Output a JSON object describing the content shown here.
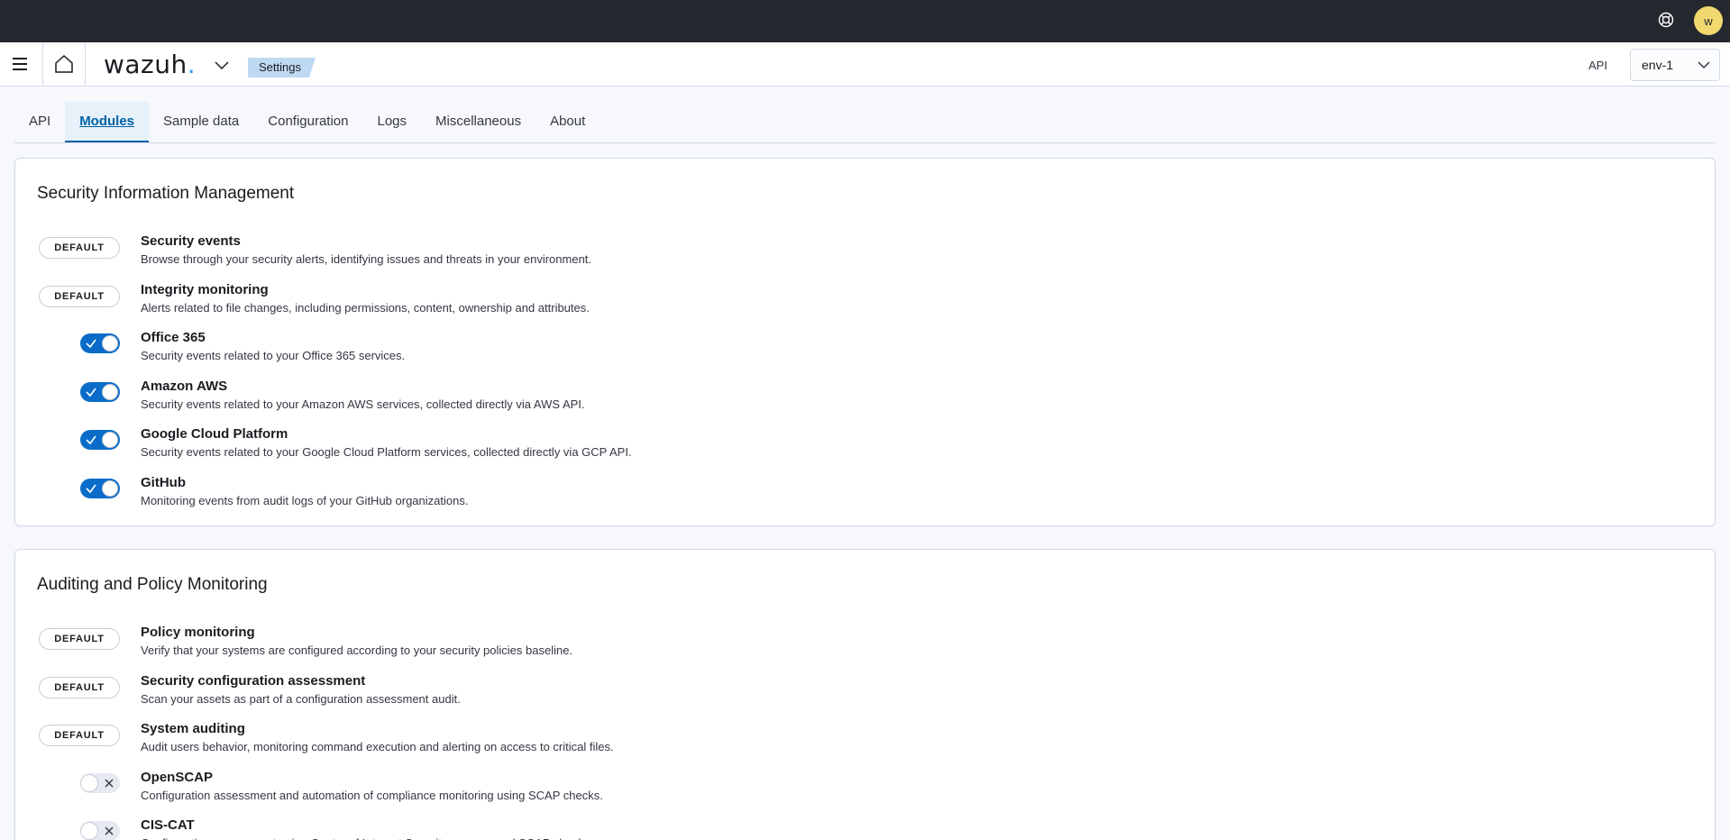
{
  "topbar": {
    "help_icon": "help-lifebuoy-icon",
    "avatar_letter": "w"
  },
  "header": {
    "menu_icon": "hamburger-menu-icon",
    "home_icon": "home-icon",
    "logo_text": "wazuh",
    "logo_dot": ".",
    "breadcrumb": "Settings",
    "api_label": "API",
    "env_value": "env-1"
  },
  "tabs": [
    {
      "label": "API"
    },
    {
      "label": "Modules",
      "selected": true
    },
    {
      "label": "Sample data"
    },
    {
      "label": "Configuration"
    },
    {
      "label": "Logs"
    },
    {
      "label": "Miscellaneous"
    },
    {
      "label": "About"
    }
  ],
  "sections": [
    {
      "title": "Security Information Management",
      "modules": [
        {
          "control": "badge",
          "badge": "DEFAULT",
          "name": "Security events",
          "desc": "Browse through your security alerts, identifying issues and threats in your environment."
        },
        {
          "control": "badge",
          "badge": "DEFAULT",
          "name": "Integrity monitoring",
          "desc": "Alerts related to file changes, including permissions, content, ownership and attributes."
        },
        {
          "control": "switch",
          "enabled": true,
          "name": "Office 365",
          "desc": "Security events related to your Office 365 services."
        },
        {
          "control": "switch",
          "enabled": true,
          "name": "Amazon AWS",
          "desc": "Security events related to your Amazon AWS services, collected directly via AWS API."
        },
        {
          "control": "switch",
          "enabled": true,
          "name": "Google Cloud Platform",
          "desc": "Security events related to your Google Cloud Platform services, collected directly via GCP API."
        },
        {
          "control": "switch",
          "enabled": true,
          "name": "GitHub",
          "desc": "Monitoring events from audit logs of your GitHub organizations."
        }
      ]
    },
    {
      "title": "Auditing and Policy Monitoring",
      "modules": [
        {
          "control": "badge",
          "badge": "DEFAULT",
          "name": "Policy monitoring",
          "desc": "Verify that your systems are configured according to your security policies baseline."
        },
        {
          "control": "badge",
          "badge": "DEFAULT",
          "name": "Security configuration assessment",
          "desc": "Scan your assets as part of a configuration assessment audit."
        },
        {
          "control": "badge",
          "badge": "DEFAULT",
          "name": "System auditing",
          "desc": "Audit users behavior, monitoring command execution and alerting on access to critical files."
        },
        {
          "control": "switch",
          "enabled": false,
          "name": "OpenSCAP",
          "desc": "Configuration assessment and automation of compliance monitoring using SCAP checks."
        },
        {
          "control": "switch",
          "enabled": false,
          "name": "CIS-CAT",
          "desc": "Configuration assessment using Center of Internet Security scanner and SCAP checks."
        }
      ]
    }
  ],
  "colors": {
    "topbar": "#25282f",
    "accent": "#0a6cc8",
    "breadcrumb": "#bfd9f2",
    "avatar": "#f1d86f",
    "logo_dot": "#3595f9"
  }
}
